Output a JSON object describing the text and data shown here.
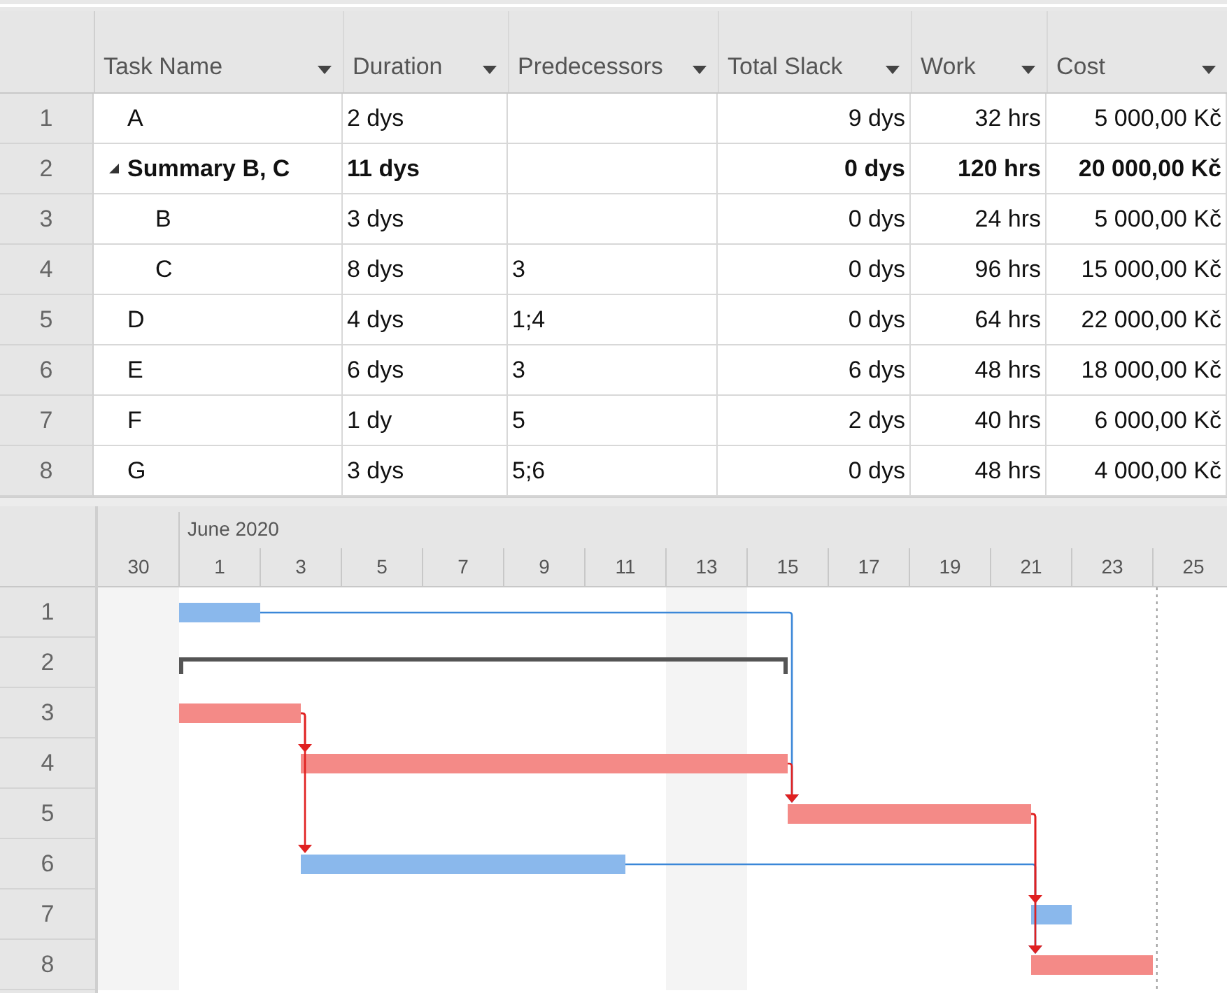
{
  "table": {
    "columns": [
      {
        "label": "Task Name"
      },
      {
        "label": "Duration"
      },
      {
        "label": "Predecessors"
      },
      {
        "label": "Total Slack"
      },
      {
        "label": "Work"
      },
      {
        "label": "Cost"
      }
    ],
    "rows": [
      {
        "number": "1",
        "cells": [
          "A",
          "2 dys",
          null,
          "9 dys",
          "32 hrs",
          "5 000,00 Kč"
        ],
        "summary": false
      },
      {
        "number": "2",
        "cells": [
          "Summary B, C",
          "11 dys",
          null,
          "0 dys",
          "120 hrs",
          "20 000,00 Kč"
        ],
        "summary": true,
        "expanded": true,
        "children": [
          {
            "number": "3",
            "cells": [
              "B",
              "3 dys",
              null,
              "0 dys",
              "24 hrs",
              "5 000,00 Kč"
            ],
            "summary": false
          },
          {
            "number": "4",
            "cells": [
              "C",
              "8 dys",
              "3",
              "0 dys",
              "96 hrs",
              "15 000,00 Kč"
            ],
            "summary": false
          }
        ]
      },
      {
        "number": "5",
        "cells": [
          "D",
          "4 dys",
          "1;4",
          "0 dys",
          "64 hrs",
          "22 000,00 Kč"
        ],
        "summary": false
      },
      {
        "number": "6",
        "cells": [
          "E",
          "6 dys",
          "3",
          "6 dys",
          "48 hrs",
          "18 000,00 Kč"
        ],
        "summary": false
      },
      {
        "number": "7",
        "cells": [
          "F",
          "1 dy",
          "5",
          "2 dys",
          "40 hrs",
          "6 000,00 Kč"
        ],
        "summary": false
      },
      {
        "number": "8",
        "cells": [
          "G",
          "3 dys",
          "5;6",
          "0 dys",
          "48 hrs",
          "4 000,00 Kč"
        ],
        "summary": false
      }
    ]
  },
  "gantt": {
    "month": "June 2020",
    "days": [
      "30",
      "1",
      "3",
      "5",
      "7",
      "9",
      "11",
      "13",
      "15",
      "17",
      "19",
      "21",
      "23",
      "25"
    ],
    "rows": [
      {
        "number": "1",
        "kind": "task",
        "critical": false
      },
      {
        "number": "2",
        "kind": "summary",
        "critical": false
      },
      {
        "number": "3",
        "kind": "task",
        "critical": true
      },
      {
        "number": "4",
        "kind": "task",
        "critical": true
      },
      {
        "number": "5",
        "kind": "task",
        "critical": true
      },
      {
        "number": "6",
        "kind": "task",
        "critical": false
      },
      {
        "number": "7",
        "kind": "task",
        "critical": false
      },
      {
        "number": "8",
        "kind": "task",
        "critical": true
      }
    ]
  }
}
